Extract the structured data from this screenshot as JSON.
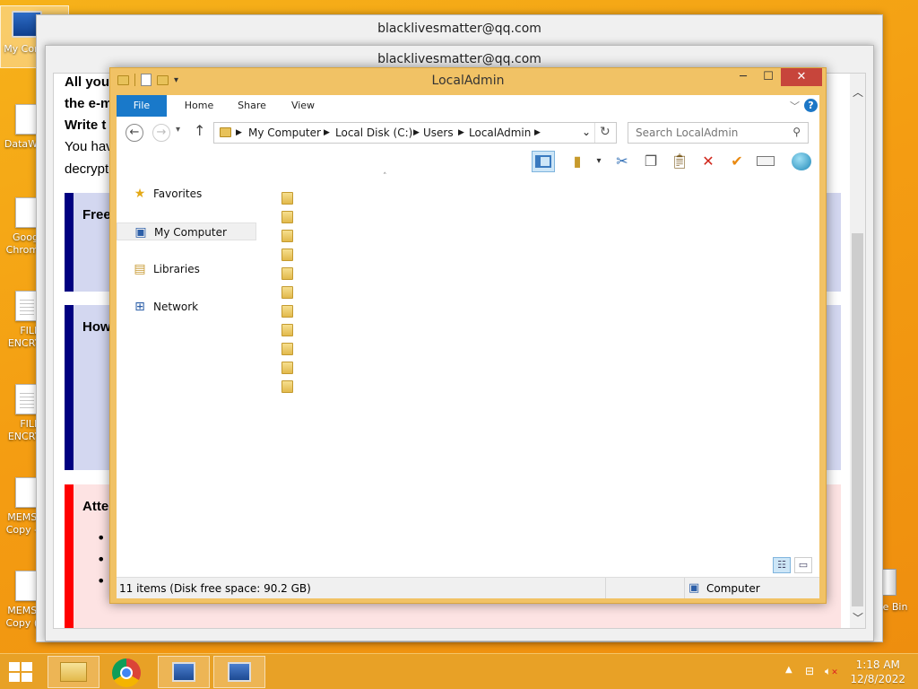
{
  "desktop": {
    "icons": [
      {
        "label": "My Comp"
      },
      {
        "label": "DataWag"
      },
      {
        "label": "Googl Chrome."
      },
      {
        "label": "FILES ENCRYP"
      },
      {
        "label": "FILES ENCRYP"
      },
      {
        "label": "MEMS 3 Copy - C"
      },
      {
        "label": "MEMS 3 Copy (2)"
      },
      {
        "label": "cle Bin"
      }
    ]
  },
  "ransom_back": {
    "title": "blacklivesmatter@qq.com"
  },
  "ransom_front": {
    "title": "blacklivesmatter@qq.com",
    "lines": [
      "All you",
      "the e-m",
      "Write t",
      "You hav",
      "decrypti"
    ],
    "sections": [
      {
        "head": "Free",
        "color": "#000080"
      },
      {
        "head": "How",
        "color": "#000080"
      },
      {
        "head": "Atte",
        "color": "#ff0000"
      }
    ]
  },
  "explorer": {
    "title": "LocalAdmin",
    "ribbon_tabs": [
      "File",
      "Home",
      "Share",
      "View"
    ],
    "breadcrumbs": [
      "My Computer",
      "Local Disk (C:)",
      "Users",
      "LocalAdmin"
    ],
    "search_placeholder": "Search LocalAdmin",
    "nav": [
      {
        "label": "Favorites",
        "icon": "star-icon"
      },
      {
        "label": "My Computer",
        "icon": "computer-icon"
      },
      {
        "label": "Libraries",
        "icon": "library-icon"
      },
      {
        "label": "Network",
        "icon": "network-icon"
      }
    ],
    "folder_count": 11,
    "status_text": "11 items (Disk free space: 90.2 GB)",
    "status_location": "Computer"
  },
  "taskbar": {
    "time": "1:18 AM",
    "date": "12/8/2022"
  }
}
